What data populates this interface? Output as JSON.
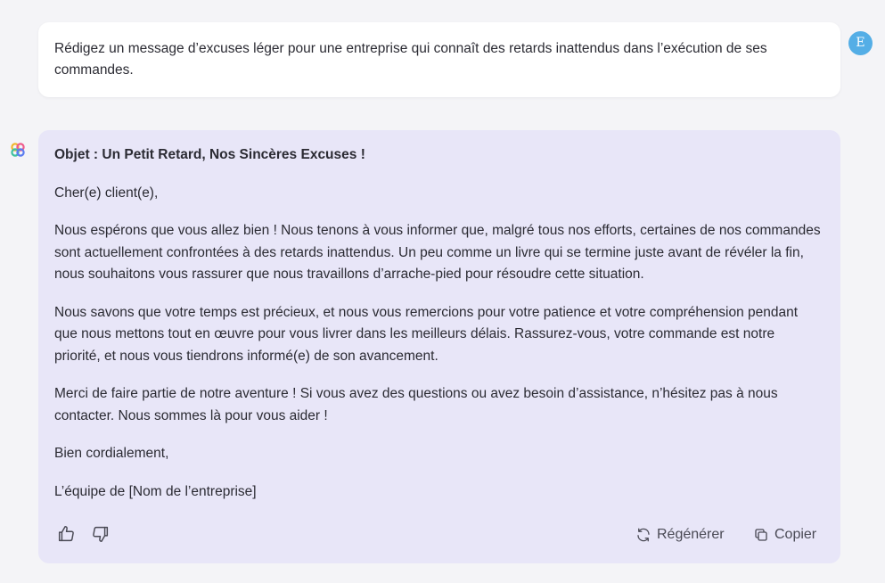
{
  "user_message": {
    "text": "Rédigez un message d’excuses léger pour une entreprise qui connaît des retards inattendus dans l’exécution de ses commandes.",
    "avatar_initial": "E"
  },
  "assistant_message": {
    "subject": "Objet : Un Petit Retard, Nos Sincères Excuses !",
    "paragraphs": [
      "Cher(e) client(e),",
      "Nous espérons que vous allez bien ! Nous tenons à vous informer que, malgré tous nos efforts, certaines de nos commandes sont actuellement confrontées à des retards inattendus. Un peu comme un livre qui se termine juste avant de révéler la fin, nous souhaitons vous rassurer que nous travaillons d’arrache-pied pour résoudre cette situation.",
      "Nous savons que votre temps est précieux, et nous vous remercions pour votre patience et votre compréhension pendant que nous mettons tout en œuvre pour vous livrer dans les meilleurs délais. Rassurez-vous, votre commande est notre priorité, et nous vous tiendrons informé(e) de son avancement.",
      "Merci de faire partie de notre aventure ! Si vous avez des questions ou avez besoin d’assistance, n’hésitez pas à nous contacter. Nous sommes là pour vous aider !",
      "Bien cordialement,",
      "L’équipe de [Nom de l’entreprise]"
    ]
  },
  "actions": {
    "regenerate_label": "Régénérer",
    "copy_label": "Copier"
  },
  "colors": {
    "background": "#f4f4f7",
    "assistant_bubble": "#e8e6f8",
    "user_bubble": "#ffffff",
    "avatar": "#54aee6"
  },
  "icons": [
    "thumbs-up-icon",
    "thumbs-down-icon",
    "regenerate-icon",
    "copy-icon",
    "assistant-logo-icon"
  ]
}
